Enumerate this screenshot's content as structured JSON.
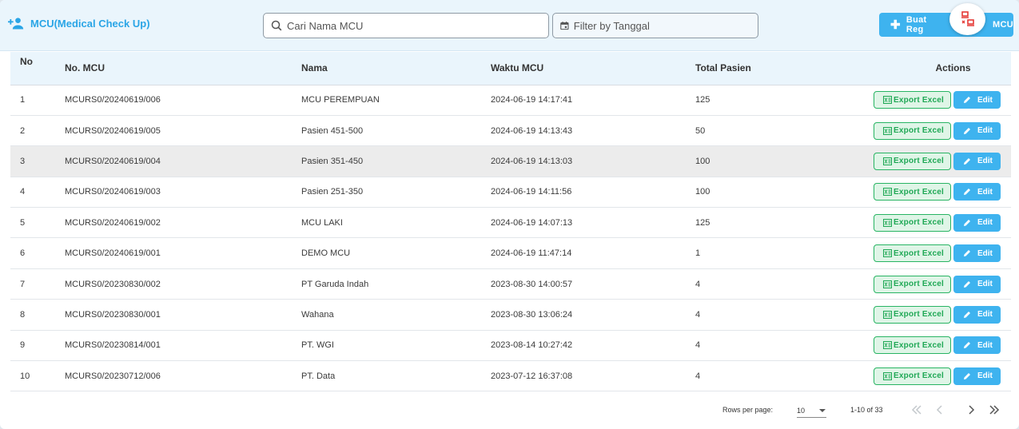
{
  "header": {
    "title": "MCU(Medical Check Up)",
    "search_placeholder": "Cari Nama MCU",
    "date_placeholder": "Filter by Tanggal",
    "new_button_label": "Buat Registrasi MCU",
    "new_button_visible_label": "Buat Reg",
    "new_button_visible_tail": "MCU"
  },
  "table": {
    "columns": [
      "No",
      "No. MCU",
      "Nama",
      "Waktu MCU",
      "Total Pasien",
      "Actions"
    ],
    "export_label": "Export Excel",
    "edit_label": "Edit",
    "rows": [
      {
        "no": "1",
        "code": "MCURS0/20240619/006",
        "name": "MCU PEREMPUAN",
        "time": "2024-06-19 14:17:41",
        "total": "125"
      },
      {
        "no": "2",
        "code": "MCURS0/20240619/005",
        "name": "Pasien 451-500",
        "time": "2024-06-19 14:13:43",
        "total": "50"
      },
      {
        "no": "3",
        "code": "MCURS0/20240619/004",
        "name": "Pasien 351-450",
        "time": "2024-06-19 14:13:03",
        "total": "100"
      },
      {
        "no": "4",
        "code": "MCURS0/20240619/003",
        "name": "Pasien 251-350",
        "time": "2024-06-19 14:11:56",
        "total": "100"
      },
      {
        "no": "5",
        "code": "MCURS0/20240619/002",
        "name": "MCU LAKI",
        "time": "2024-06-19 14:07:13",
        "total": "125"
      },
      {
        "no": "6",
        "code": "MCURS0/20240619/001",
        "name": "DEMO MCU",
        "time": "2024-06-19 11:47:14",
        "total": "1"
      },
      {
        "no": "7",
        "code": "MCURS0/20230830/002",
        "name": "PT Garuda Indah",
        "time": "2023-08-30 14:00:57",
        "total": "4"
      },
      {
        "no": "8",
        "code": "MCURS0/20230830/001",
        "name": "Wahana",
        "time": "2023-08-30 13:06:24",
        "total": "4"
      },
      {
        "no": "9",
        "code": "MCURS0/20230814/001",
        "name": "PT. WGI",
        "time": "2023-08-14 10:27:42",
        "total": "4"
      },
      {
        "no": "10",
        "code": "MCURS0/20230712/006",
        "name": "PT. Data",
        "time": "2023-07-12 16:37:08",
        "total": "4"
      }
    ]
  },
  "pagination": {
    "rows_per_page_label": "Rows per page:",
    "rows_per_page_value": "10",
    "range_text": "1-10 of 33"
  },
  "colors": {
    "accent": "#3eb3ef",
    "header_bg": "#eaf5fc",
    "export_green": "#1fa855",
    "fab_red": "#e53935"
  },
  "icons": [
    "add-user-icon",
    "search-icon",
    "calendar-icon",
    "plus-icon",
    "network-error-icon",
    "excel-icon",
    "pencil-icon",
    "chevron-down-icon",
    "first-page-icon",
    "prev-page-icon",
    "next-page-icon",
    "last-page-icon"
  ]
}
